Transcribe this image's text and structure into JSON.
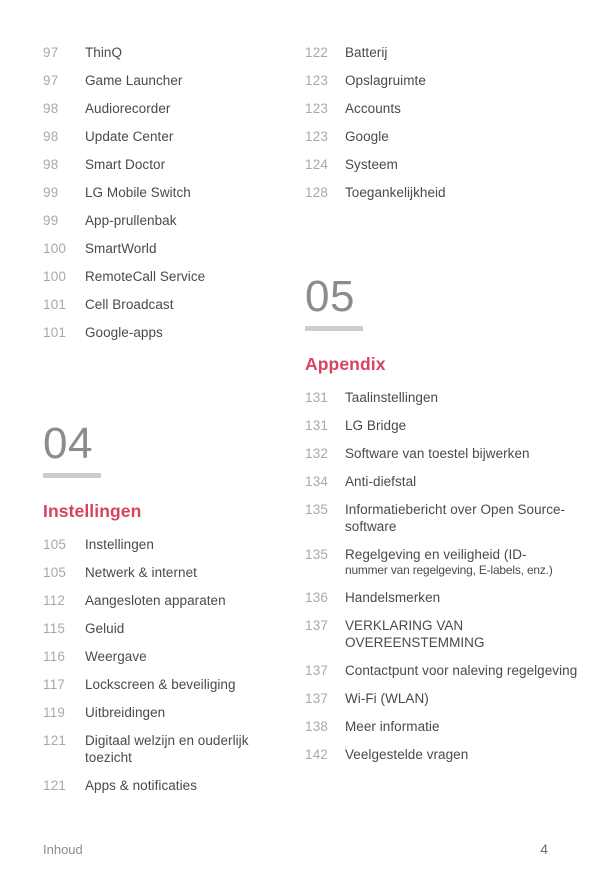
{
  "document": {
    "footer_label": "Inhoud",
    "page_number": "4"
  },
  "theme": {
    "accent_red": "#d9435e",
    "number_gray": "#a9a9a9",
    "title_gray": "#4a4a4a",
    "chapter_gray": "#8c8c8c",
    "rule_gray": "#cdcdcd",
    "background": "#ffffff"
  },
  "left_column": {
    "continued_entries": [
      {
        "page": "97",
        "title": "ThinQ"
      },
      {
        "page": "97",
        "title": "Game Launcher"
      },
      {
        "page": "98",
        "title": "Audiorecorder"
      },
      {
        "page": "98",
        "title": "Update Center"
      },
      {
        "page": "98",
        "title": "Smart Doctor"
      },
      {
        "page": "99",
        "title": "LG Mobile Switch"
      },
      {
        "page": "99",
        "title": "App-prullenbak"
      },
      {
        "page": "100",
        "title": "SmartWorld"
      },
      {
        "page": "100",
        "title": "RemoteCall Service"
      },
      {
        "page": "101",
        "title": "Cell Broadcast"
      },
      {
        "page": "101",
        "title": "Google-apps"
      }
    ],
    "chapter": {
      "number": "04",
      "title": "Instellingen",
      "entries": [
        {
          "page": "105",
          "title": "Instellingen"
        },
        {
          "page": "105",
          "title": "Netwerk & internet"
        },
        {
          "page": "112",
          "title": "Aangesloten apparaten"
        },
        {
          "page": "115",
          "title": "Geluid"
        },
        {
          "page": "116",
          "title": "Weergave"
        },
        {
          "page": "117",
          "title": "Lockscreen & beveiliging"
        },
        {
          "page": "119",
          "title": "Uitbreidingen"
        },
        {
          "page": "121",
          "title": "Digitaal welzijn en ouderlijk toezicht"
        },
        {
          "page": "121",
          "title": "Apps & notificaties"
        }
      ]
    }
  },
  "right_column": {
    "continued_entries": [
      {
        "page": "122",
        "title": "Batterij"
      },
      {
        "page": "123",
        "title": "Opslagruimte"
      },
      {
        "page": "123",
        "title": "Accounts"
      },
      {
        "page": "123",
        "title": "Google"
      },
      {
        "page": "124",
        "title": "Systeem"
      },
      {
        "page": "128",
        "title": "Toegankelijkheid"
      }
    ],
    "chapter": {
      "number": "05",
      "title": "Appendix",
      "entries": [
        {
          "page": "131",
          "title": "Taalinstellingen"
        },
        {
          "page": "131",
          "title": "LG Bridge"
        },
        {
          "page": "132",
          "title": "Software van toestel bijwerken"
        },
        {
          "page": "134",
          "title": "Anti-diefstal"
        },
        {
          "page": "135",
          "title": "Informatiebericht over Open Source-software"
        },
        {
          "page": "135",
          "title": "Regelgeving en veiligheid (ID-",
          "subtitle": "nummer van regelgeving, E-labels, enz.)"
        },
        {
          "page": "136",
          "title": "Handelsmerken"
        },
        {
          "page": "137",
          "title": "VERKLARING VAN OVEREENSTEMMING"
        },
        {
          "page": "137",
          "title": "Contactpunt voor naleving regelgeving"
        },
        {
          "page": "137",
          "title": "Wi-Fi (WLAN)"
        },
        {
          "page": "138",
          "title": "Meer informatie"
        },
        {
          "page": "142",
          "title": "Veelgestelde vragen"
        }
      ]
    }
  }
}
